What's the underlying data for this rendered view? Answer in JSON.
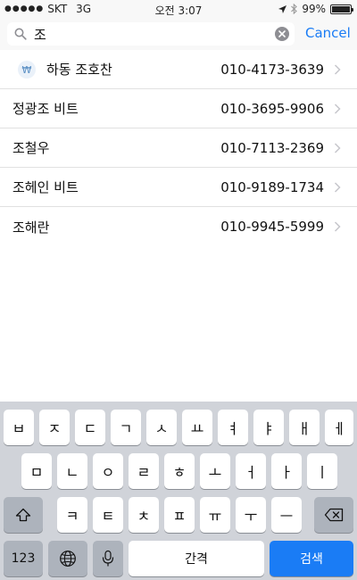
{
  "status_bar": {
    "carrier": "SKT",
    "network": "3G",
    "time": "오전 3:07",
    "battery": "99%",
    "battery_level": 0.99
  },
  "search": {
    "query": "조",
    "placeholder": "",
    "cancel_label": "Cancel"
  },
  "results": [
    {
      "name": "하동 조호찬",
      "phone": "010-4173-3639",
      "badge": "₩"
    },
    {
      "name": "정광조 비트",
      "phone": "010-3695-9906"
    },
    {
      "name": "조철우",
      "phone": "010-7113-2369"
    },
    {
      "name": "조헤인 비트",
      "phone": "010-9189-1734"
    },
    {
      "name": "조해란",
      "phone": "010-9945-5999"
    }
  ],
  "keyboard": {
    "row1": [
      "ㅂ",
      "ㅈ",
      "ㄷ",
      "ㄱ",
      "ㅅ",
      "ㅛ",
      "ㅕ",
      "ㅑ",
      "ㅐ",
      "ㅔ"
    ],
    "row2": [
      "ㅁ",
      "ㄴ",
      "ㅇ",
      "ㄹ",
      "ㅎ",
      "ㅗ",
      "ㅓ",
      "ㅏ",
      "ㅣ"
    ],
    "row3": [
      "ㅋ",
      "ㅌ",
      "ㅊ",
      "ㅍ",
      "ㅠ",
      "ㅜ",
      "ㅡ"
    ],
    "num_label": "123",
    "space_label": "간격",
    "search_label": "검색"
  },
  "colors": {
    "accent": "#1a7cf5",
    "keyboard_bg": "#d0d3d9"
  }
}
